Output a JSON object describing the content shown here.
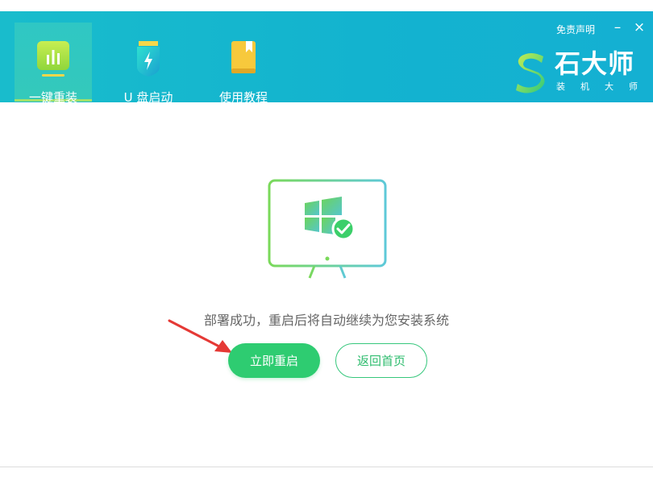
{
  "header": {
    "tabs": [
      {
        "label": "一键重装",
        "icon": "chart-icon",
        "active": true
      },
      {
        "label": "U 盘启动",
        "icon": "usb-drive-icon",
        "active": false
      },
      {
        "label": "使用教程",
        "icon": "book-icon",
        "active": false
      }
    ],
    "disclaimer": "免责声明",
    "minimize_symbol": "–",
    "close_symbol": "×",
    "brand": {
      "name": "石大师",
      "subtitle": "装机大师"
    }
  },
  "main": {
    "message": "部署成功，重启后将自动继续为您安装系统",
    "restart_label": "立即重启",
    "home_label": "返回首页"
  },
  "colors": {
    "header": "#14b5cf",
    "accent_green": "#2ecc71",
    "arrow_red": "#e53935"
  }
}
